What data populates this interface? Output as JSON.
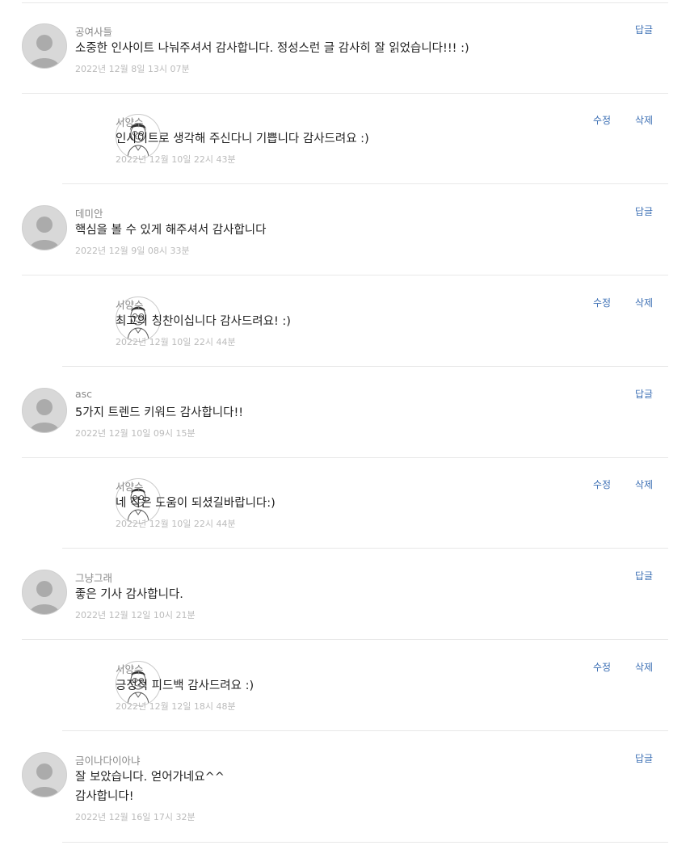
{
  "comments": [
    {
      "author": "공여사들",
      "text": "소중한 인사이트 나눠주셔서 감사합니다. 정성스런 글 감사히 잘 읽었습니다!!! :)",
      "date": "2022년 12월 8일 13시 07분",
      "reply_label": "답글",
      "reply": {
        "author": "서양수",
        "text": "인사이트로 생각해 주신다니 기쁩니다 감사드려요 :)",
        "date": "2022년 12월 10일 22시 43분",
        "edit_label": "수정",
        "delete_label": "삭제"
      }
    },
    {
      "author": "데미안",
      "text": "핵심을 볼 수 있게 해주셔서 감사합니다",
      "date": "2022년 12월 9일 08시 33분",
      "reply_label": "답글",
      "reply": {
        "author": "서양수",
        "text": "최고의 칭찬이십니다 감사드려요! :)",
        "date": "2022년 12월 10일 22시 44분",
        "edit_label": "수정",
        "delete_label": "삭제"
      }
    },
    {
      "author": "asc",
      "text": "5가지 트렌드 키워드 감사합니다!!",
      "date": "2022년 12월 10일 09시 15분",
      "reply_label": "답글",
      "reply": {
        "author": "서양수",
        "text": "네 작은 도움이 되셨길바랍니다:)",
        "date": "2022년 12월 10일 22시 44분",
        "edit_label": "수정",
        "delete_label": "삭제"
      }
    },
    {
      "author": "그냥그래",
      "text": "좋은 기사 감사합니다.",
      "date": "2022년 12월 12일 10시 21분",
      "reply_label": "답글",
      "reply": {
        "author": "서양수",
        "text": "긍정적 피드백 감사드려요 :)",
        "date": "2022년 12월 12일 18시 48분",
        "edit_label": "수정",
        "delete_label": "삭제"
      }
    }
  ],
  "last_comment": {
    "author": "금이나다이아냐",
    "text_line1": "잘 보았습니다. 얻어가네요^^",
    "text_line2": "감사합니다!",
    "date": "2022년 12월 16일 17시 32분",
    "reply_label": "답글"
  },
  "colors": {
    "link": "#3c6fb4",
    "author_text": "#888888",
    "date_text": "#bbbbbb",
    "divider": "#e8e8e8"
  }
}
